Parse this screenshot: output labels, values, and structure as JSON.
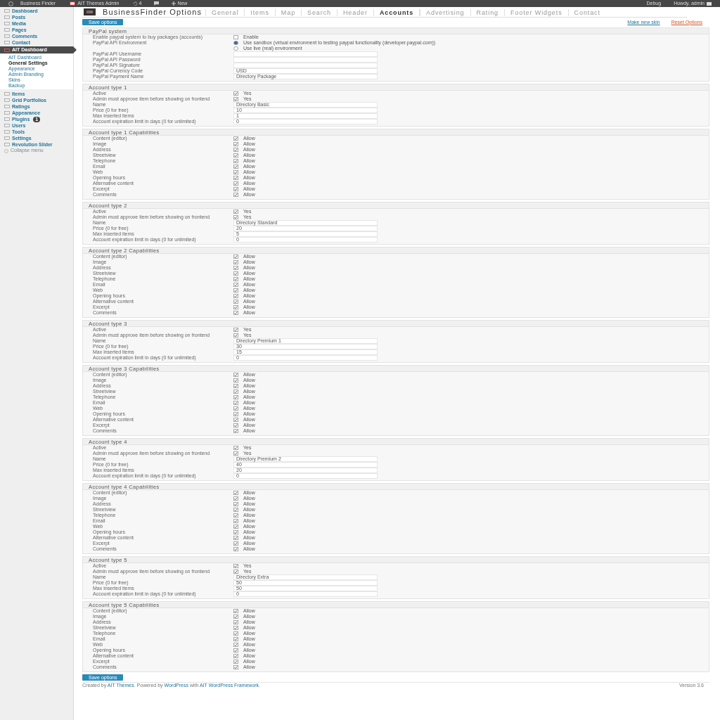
{
  "top_bar": {
    "site": "Business Finder",
    "admin": "AIT Themes Admin",
    "comments": "4",
    "new": "New",
    "debug": "Debug",
    "howdy": "Howdy, admin"
  },
  "sidebar": {
    "items": [
      {
        "label": "Dashboard",
        "selected": false
      },
      {
        "label": "Posts",
        "selected": false
      },
      {
        "label": "Media",
        "selected": false
      },
      {
        "label": "Pages",
        "selected": false
      },
      {
        "label": "Comments",
        "selected": false
      },
      {
        "label": "Contact",
        "selected": false
      },
      {
        "label": "AIT Dashboard",
        "selected": true,
        "children": [
          {
            "label": "AIT Dashboard",
            "selected": false
          },
          {
            "label": "General Settings",
            "selected": true
          },
          {
            "label": "Appearance",
            "selected": false
          },
          {
            "label": "Admin Branding",
            "selected": false
          },
          {
            "label": "Skins",
            "selected": false
          },
          {
            "label": "Backup",
            "selected": false
          }
        ]
      },
      {
        "label": "Items",
        "selected": false
      },
      {
        "label": "Grid Portfolios",
        "selected": false
      },
      {
        "label": "Ratings",
        "selected": false
      },
      {
        "label": "Appearance",
        "selected": false
      },
      {
        "label": "Plugins",
        "selected": false,
        "badge": "1"
      },
      {
        "label": "Users",
        "selected": false
      },
      {
        "label": "Tools",
        "selected": false
      },
      {
        "label": "Settings",
        "selected": false
      },
      {
        "label": "Revolution Slider",
        "selected": false
      }
    ],
    "collapse": "Collapse menu"
  },
  "page": {
    "title": "BusinessFinder Options",
    "tabs": [
      {
        "label": "General",
        "selected": false
      },
      {
        "label": "Items",
        "selected": false
      },
      {
        "label": "Map",
        "selected": false
      },
      {
        "label": "Search",
        "selected": false
      },
      {
        "label": "Header",
        "selected": false
      },
      {
        "label": "Accounts",
        "selected": true
      },
      {
        "label": "Advertising",
        "selected": false
      },
      {
        "label": "Rating",
        "selected": false
      },
      {
        "label": "Footer Widgets",
        "selected": false
      },
      {
        "label": "Contact",
        "selected": false
      }
    ],
    "save_button": "Save options",
    "links": [
      {
        "label": "Make new skin",
        "kind": "normal"
      },
      {
        "label": "Reset Options",
        "kind": "danger"
      }
    ]
  },
  "sections": [
    {
      "title": "PayPal system",
      "rows": [
        {
          "kind": "checkbox",
          "label": "Enable paypal system to buy packages (accounts)",
          "checked": false,
          "option": "Enable"
        },
        {
          "kind": "radio",
          "label": "PayPal API Environment",
          "options": [
            {
              "label": "Use sandbox (virtual environment to testing paypal functionality (developer.paypal.com))",
              "selected": true
            },
            {
              "label": "Use live (real) environment",
              "selected": false
            }
          ]
        },
        {
          "kind": "text",
          "label": "PayPal API Username"
        },
        {
          "kind": "text",
          "label": "PayPal API Password"
        },
        {
          "kind": "text",
          "label": "PayPal API Signature"
        },
        {
          "kind": "text",
          "label": "PayPal Currency Code",
          "value": "USD"
        },
        {
          "kind": "text",
          "label": "PayPal Payment Name",
          "value": "Directory Package"
        }
      ]
    },
    {
      "title": "Account type 1",
      "rows": [
        {
          "kind": "checkbox",
          "label": "Active",
          "checked": true,
          "option": "Yes"
        },
        {
          "kind": "checkbox",
          "label": "Admin must approve item before showing on frontend",
          "checked": true,
          "option": "Yes"
        },
        {
          "kind": "text",
          "label": "Name",
          "value": "Directory Basic"
        },
        {
          "kind": "text",
          "label": "Price (0 for free)",
          "value": "10"
        },
        {
          "kind": "text",
          "label": "Max inserted items",
          "value": "1"
        },
        {
          "kind": "text",
          "label": "Account expiration limit in days (0 for unlimited)",
          "value": "0"
        }
      ]
    },
    {
      "title": "Account type 1 Capabilities",
      "rows": [
        {
          "kind": "checkbox",
          "label": "Content (editor)",
          "checked": true,
          "option": "Allow"
        },
        {
          "kind": "checkbox",
          "label": "Image",
          "checked": true,
          "option": "Allow"
        },
        {
          "kind": "checkbox",
          "label": "Address",
          "checked": true,
          "option": "Allow"
        },
        {
          "kind": "checkbox",
          "label": "Streetview",
          "checked": true,
          "option": "Allow"
        },
        {
          "kind": "checkbox",
          "label": "Telephone",
          "checked": true,
          "option": "Allow"
        },
        {
          "kind": "checkbox",
          "label": "Email",
          "checked": true,
          "option": "Allow"
        },
        {
          "kind": "checkbox",
          "label": "Web",
          "checked": true,
          "option": "Allow"
        },
        {
          "kind": "checkbox",
          "label": "Opening hours",
          "checked": true,
          "option": "Allow"
        },
        {
          "kind": "checkbox",
          "label": "Alternative content",
          "checked": true,
          "option": "Allow"
        },
        {
          "kind": "checkbox",
          "label": "Excerpt",
          "checked": true,
          "option": "Allow"
        },
        {
          "kind": "checkbox",
          "label": "Comments",
          "checked": true,
          "option": "Allow"
        }
      ]
    },
    {
      "title": "Account type 2",
      "rows": [
        {
          "kind": "checkbox",
          "label": "Active",
          "checked": true,
          "option": "Yes"
        },
        {
          "kind": "checkbox",
          "label": "Admin must approve item before showing on frontend",
          "checked": true,
          "option": "Yes"
        },
        {
          "kind": "text",
          "label": "Name",
          "value": "Directory Standard"
        },
        {
          "kind": "text",
          "label": "Price (0 for free)",
          "value": "20"
        },
        {
          "kind": "text",
          "label": "Max inserted items",
          "value": "5"
        },
        {
          "kind": "text",
          "label": "Account expiration limit in days (0 for unlimited)",
          "value": "0"
        }
      ]
    },
    {
      "title": "Account type 2 Capabilities",
      "rows": [
        {
          "kind": "checkbox",
          "label": "Content (editor)",
          "checked": true,
          "option": "Allow"
        },
        {
          "kind": "checkbox",
          "label": "Image",
          "checked": true,
          "option": "Allow"
        },
        {
          "kind": "checkbox",
          "label": "Address",
          "checked": true,
          "option": "Allow"
        },
        {
          "kind": "checkbox",
          "label": "Streetview",
          "checked": true,
          "option": "Allow"
        },
        {
          "kind": "checkbox",
          "label": "Telephone",
          "checked": true,
          "option": "Allow"
        },
        {
          "kind": "checkbox",
          "label": "Email",
          "checked": true,
          "option": "Allow"
        },
        {
          "kind": "checkbox",
          "label": "Web",
          "checked": true,
          "option": "Allow"
        },
        {
          "kind": "checkbox",
          "label": "Opening hours",
          "checked": true,
          "option": "Allow"
        },
        {
          "kind": "checkbox",
          "label": "Alternative content",
          "checked": true,
          "option": "Allow"
        },
        {
          "kind": "checkbox",
          "label": "Excerpt",
          "checked": true,
          "option": "Allow"
        },
        {
          "kind": "checkbox",
          "label": "Comments",
          "checked": true,
          "option": "Allow"
        }
      ]
    },
    {
      "title": "Account type 3",
      "rows": [
        {
          "kind": "checkbox",
          "label": "Active",
          "checked": true,
          "option": "Yes"
        },
        {
          "kind": "checkbox",
          "label": "Admin must approve item before showing on frontend",
          "checked": true,
          "option": "Yes"
        },
        {
          "kind": "text",
          "label": "Name",
          "value": "Directory Premium 1"
        },
        {
          "kind": "text",
          "label": "Price (0 for free)",
          "value": "30"
        },
        {
          "kind": "text",
          "label": "Max inserted items",
          "value": "15"
        },
        {
          "kind": "text",
          "label": "Account expiration limit in days (0 for unlimited)",
          "value": "0"
        }
      ]
    },
    {
      "title": "Account type 3 Capabilities",
      "rows": [
        {
          "kind": "checkbox",
          "label": "Content (editor)",
          "checked": true,
          "option": "Allow"
        },
        {
          "kind": "checkbox",
          "label": "Image",
          "checked": true,
          "option": "Allow"
        },
        {
          "kind": "checkbox",
          "label": "Address",
          "checked": true,
          "option": "Allow"
        },
        {
          "kind": "checkbox",
          "label": "Streetview",
          "checked": true,
          "option": "Allow"
        },
        {
          "kind": "checkbox",
          "label": "Telephone",
          "checked": true,
          "option": "Allow"
        },
        {
          "kind": "checkbox",
          "label": "Email",
          "checked": true,
          "option": "Allow"
        },
        {
          "kind": "checkbox",
          "label": "Web",
          "checked": true,
          "option": "Allow"
        },
        {
          "kind": "checkbox",
          "label": "Opening hours",
          "checked": true,
          "option": "Allow"
        },
        {
          "kind": "checkbox",
          "label": "Alternative content",
          "checked": true,
          "option": "Allow"
        },
        {
          "kind": "checkbox",
          "label": "Excerpt",
          "checked": true,
          "option": "Allow"
        },
        {
          "kind": "checkbox",
          "label": "Comments",
          "checked": true,
          "option": "Allow"
        }
      ]
    },
    {
      "title": "Account type 4",
      "rows": [
        {
          "kind": "checkbox",
          "label": "Active",
          "checked": true,
          "option": "Yes"
        },
        {
          "kind": "checkbox",
          "label": "Admin must approve item before showing on frontend",
          "checked": true,
          "option": "Yes"
        },
        {
          "kind": "text",
          "label": "Name",
          "value": "Directory Premium 2"
        },
        {
          "kind": "text",
          "label": "Price (0 for free)",
          "value": "40"
        },
        {
          "kind": "text",
          "label": "Max inserted items",
          "value": "20"
        },
        {
          "kind": "text",
          "label": "Account expiration limit in days (0 for unlimited)",
          "value": "0"
        }
      ]
    },
    {
      "title": "Account type 4 Capabilities",
      "rows": [
        {
          "kind": "checkbox",
          "label": "Content (editor)",
          "checked": true,
          "option": "Allow"
        },
        {
          "kind": "checkbox",
          "label": "Image",
          "checked": true,
          "option": "Allow"
        },
        {
          "kind": "checkbox",
          "label": "Address",
          "checked": true,
          "option": "Allow"
        },
        {
          "kind": "checkbox",
          "label": "Streetview",
          "checked": true,
          "option": "Allow"
        },
        {
          "kind": "checkbox",
          "label": "Telephone",
          "checked": true,
          "option": "Allow"
        },
        {
          "kind": "checkbox",
          "label": "Email",
          "checked": true,
          "option": "Allow"
        },
        {
          "kind": "checkbox",
          "label": "Web",
          "checked": true,
          "option": "Allow"
        },
        {
          "kind": "checkbox",
          "label": "Opening hours",
          "checked": true,
          "option": "Allow"
        },
        {
          "kind": "checkbox",
          "label": "Alternative content",
          "checked": true,
          "option": "Allow"
        },
        {
          "kind": "checkbox",
          "label": "Excerpt",
          "checked": true,
          "option": "Allow"
        },
        {
          "kind": "checkbox",
          "label": "Comments",
          "checked": true,
          "option": "Allow"
        }
      ]
    },
    {
      "title": "Account type 5",
      "rows": [
        {
          "kind": "checkbox",
          "label": "Active",
          "checked": true,
          "option": "Yes"
        },
        {
          "kind": "checkbox",
          "label": "Admin must approve item before showing on frontend",
          "checked": true,
          "option": "Yes"
        },
        {
          "kind": "text",
          "label": "Name",
          "value": "Directory Extra"
        },
        {
          "kind": "text",
          "label": "Price (0 for free)",
          "value": "50"
        },
        {
          "kind": "text",
          "label": "Max inserted items",
          "value": "50"
        },
        {
          "kind": "text",
          "label": "Account expiration limit in days (0 for unlimited)",
          "value": "0"
        }
      ]
    },
    {
      "title": "Account type 5 Capabilities",
      "rows": [
        {
          "kind": "checkbox",
          "label": "Content (editor)",
          "checked": true,
          "option": "Allow"
        },
        {
          "kind": "checkbox",
          "label": "Image",
          "checked": true,
          "option": "Allow"
        },
        {
          "kind": "checkbox",
          "label": "Address",
          "checked": true,
          "option": "Allow"
        },
        {
          "kind": "checkbox",
          "label": "Streetview",
          "checked": true,
          "option": "Allow"
        },
        {
          "kind": "checkbox",
          "label": "Telephone",
          "checked": true,
          "option": "Allow"
        },
        {
          "kind": "checkbox",
          "label": "Email",
          "checked": true,
          "option": "Allow"
        },
        {
          "kind": "checkbox",
          "label": "Web",
          "checked": true,
          "option": "Allow"
        },
        {
          "kind": "checkbox",
          "label": "Opening hours",
          "checked": true,
          "option": "Allow"
        },
        {
          "kind": "checkbox",
          "label": "Alternative content",
          "checked": true,
          "option": "Allow"
        },
        {
          "kind": "checkbox",
          "label": "Excerpt",
          "checked": true,
          "option": "Allow"
        },
        {
          "kind": "checkbox",
          "label": "Comments",
          "checked": true,
          "option": "Allow"
        }
      ]
    }
  ],
  "bottom_save_button": "Save options",
  "footer": {
    "credit": [
      {
        "kind": "text",
        "text": "Created by "
      },
      {
        "kind": "link",
        "text": "AIT Themes"
      },
      {
        "kind": "text",
        "text": ". Powered by "
      },
      {
        "kind": "link",
        "text": "WordPress"
      },
      {
        "kind": "text",
        "text": " with "
      },
      {
        "kind": "link",
        "text": "AIT WordPress Framework"
      },
      {
        "kind": "text",
        "text": "."
      }
    ],
    "version": "Version 3.6"
  }
}
